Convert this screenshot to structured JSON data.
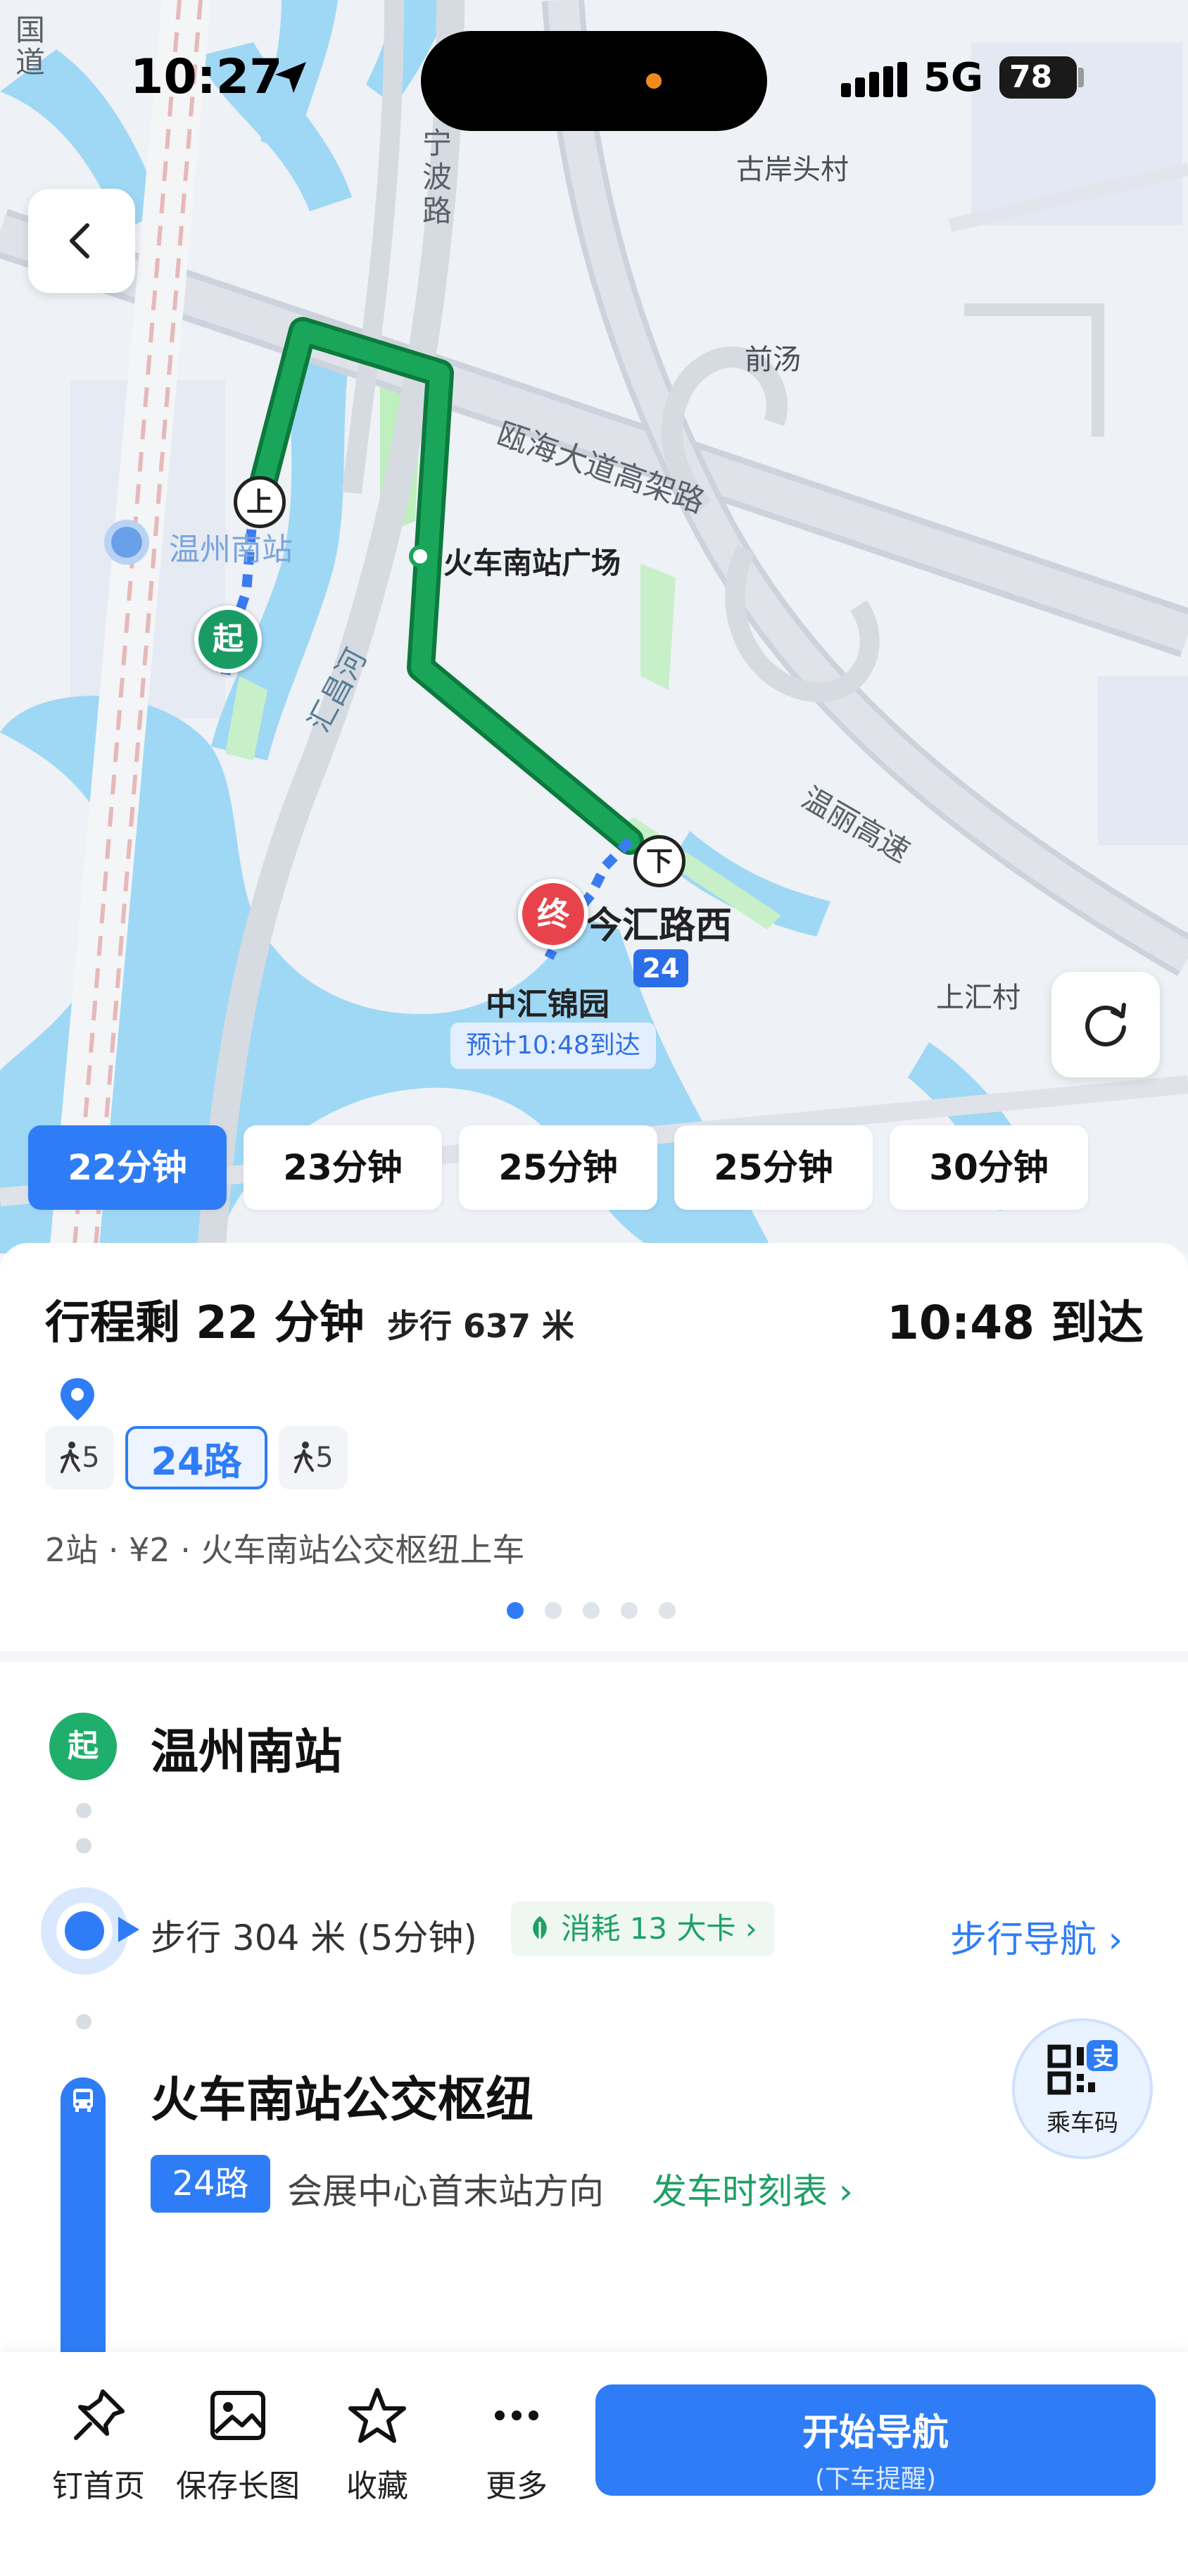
{
  "status_bar": {
    "time": "10:27",
    "network": "5G",
    "battery": "78"
  },
  "map": {
    "labels": {
      "guan_dao": "国道",
      "ningbo_road": "宁波路",
      "guanantou_village": "古岸头村",
      "qiantang": "前汤",
      "ouhai_elevated": "瓯海大道高架路",
      "wenzhou_south_station": "温州南站",
      "station_plaza": "火车南站广场",
      "huichang_river": "汇昌河",
      "wenli_expressway": "温丽高速",
      "jinhui_road_west": "今汇路西",
      "zhonghui_jinyuan": "中汇锦园",
      "shanghui_village": "上汇村"
    },
    "markers": {
      "board": "上",
      "alight": "下",
      "start": "起",
      "end": "终"
    },
    "route_badge": "24",
    "eta_tag": "预计10:48到达"
  },
  "route_options": [
    {
      "label": "22分钟",
      "active": true
    },
    {
      "label": "23分钟",
      "active": false
    },
    {
      "label": "25分钟",
      "active": false
    },
    {
      "label": "25分钟",
      "active": false
    },
    {
      "label": "30分钟",
      "active": false
    }
  ],
  "summary": {
    "title": "行程剩 22 分钟",
    "walk": "步行 637 米",
    "arrival": "10:48 到达",
    "walk_before": "5",
    "bus_route": "24路",
    "walk_after": "5",
    "meta": "2站 · ¥2 · 火车南站公交枢纽上车"
  },
  "detail": {
    "start_badge": "起",
    "start_name": "温州南站",
    "walk_text": "步行 304 米 (5分钟)",
    "calories": "消耗 13 大卡 ›",
    "walk_nav": "步行导航 ›",
    "hub_name": "火车南站公交枢纽",
    "route_chip": "24路",
    "direction": "会展中心首末站方向",
    "schedule": "发车时刻表 ›",
    "qr_label": "乘车码"
  },
  "bottom_bar": {
    "pin": "钉首页",
    "save": "保存长图",
    "favorite": "收藏",
    "more": "更多",
    "start_nav": "开始导航",
    "start_nav_sub": "(下车提醒)"
  },
  "colors": {
    "accent": "#2f7df6",
    "route_green": "#1aa65a",
    "water": "#9fd8f5",
    "start_green": "#1fae6b",
    "end_red": "#e8434c"
  }
}
